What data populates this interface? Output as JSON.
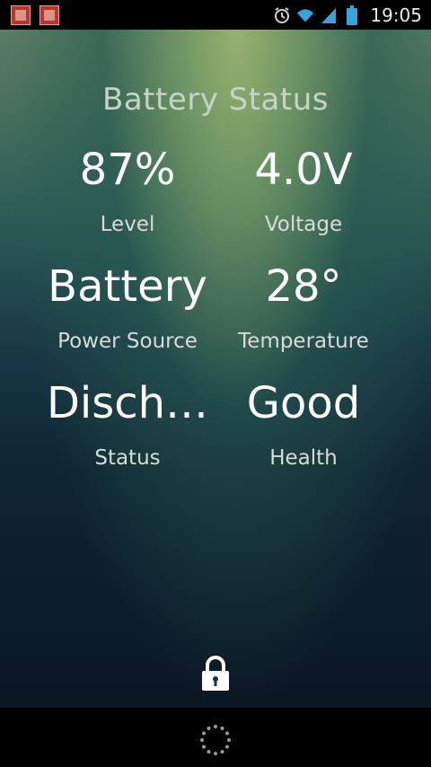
{
  "status_bar": {
    "time": "19:05",
    "icons": [
      "notification-app-icon",
      "notification-app-icon",
      "alarm-icon",
      "wifi-icon",
      "signal-icon",
      "battery-icon"
    ]
  },
  "screen": {
    "title": "Battery Status",
    "stats": [
      {
        "value": "87%",
        "label": "Level"
      },
      {
        "value": "4.0V",
        "label": "Voltage"
      },
      {
        "value": "Battery",
        "label": "Power Source"
      },
      {
        "value": "28°",
        "label": "Temperature"
      },
      {
        "value": "Disch…",
        "label": "Status"
      },
      {
        "value": "Good",
        "label": "Health"
      }
    ]
  },
  "colors": {
    "accent_top": "#9bb46e",
    "background_bottom": "#0a1724",
    "status_bar": "#000000"
  }
}
